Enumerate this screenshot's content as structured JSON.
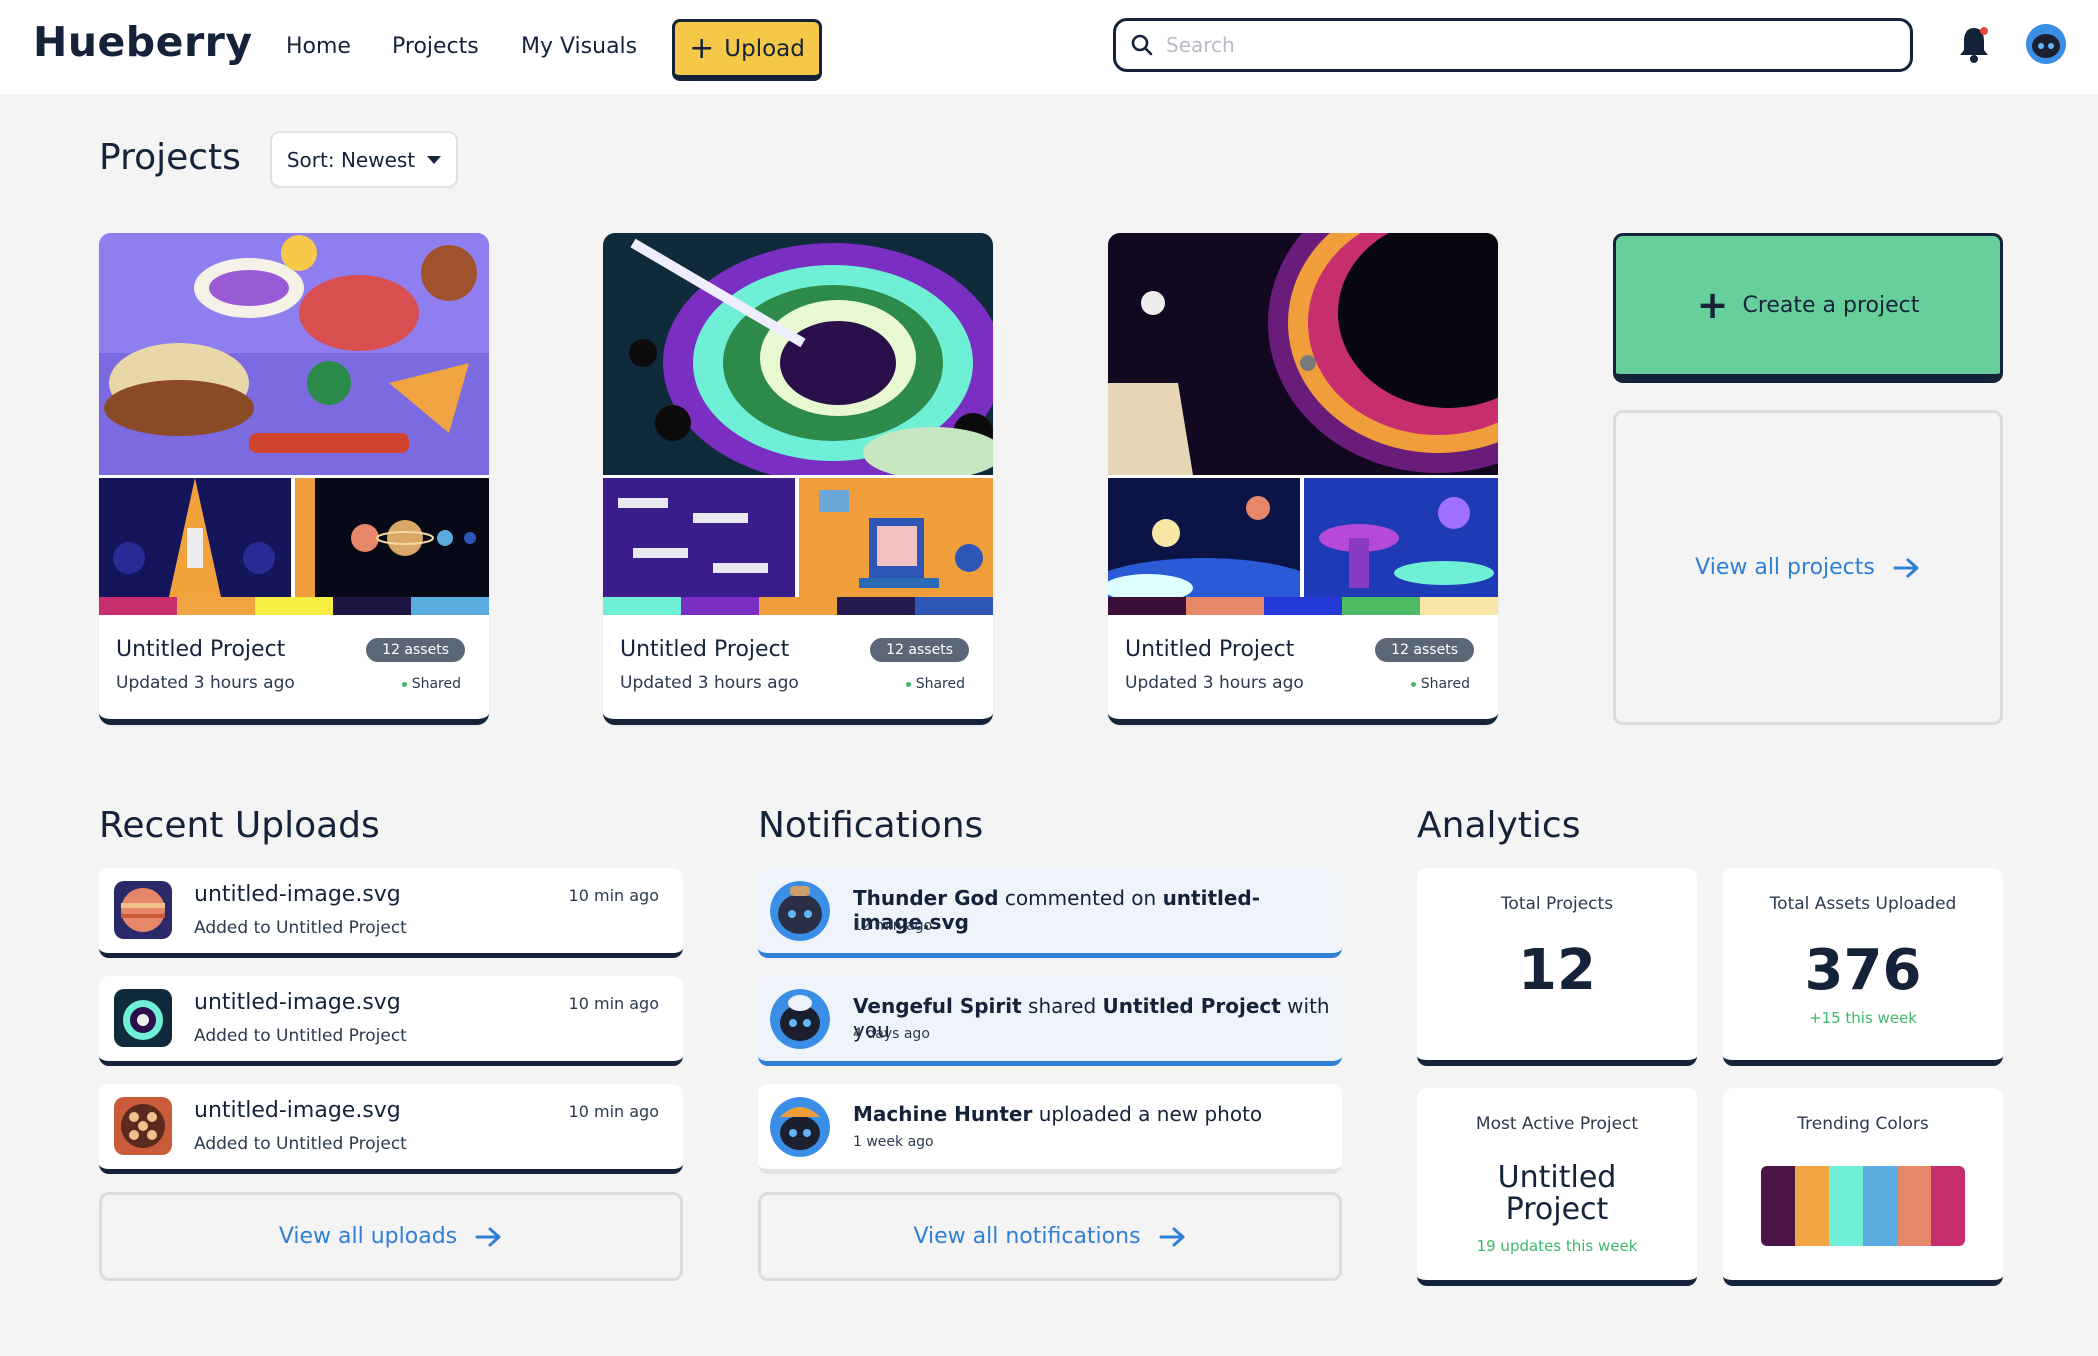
{
  "header": {
    "logo": "Hueberry",
    "nav": [
      "Home",
      "Projects",
      "My Visuals"
    ],
    "upload_label": "Upload",
    "search_placeholder": "Search",
    "colors": {
      "accent": "#f6c847",
      "brand_dark": "#14233a",
      "link": "#2f7fd6"
    }
  },
  "projects_section": {
    "title": "Projects",
    "sort_label": "Sort: Newest",
    "cards": [
      {
        "name": "Untitled Project",
        "updated": "Updated 3 hours ago",
        "assets": "12 assets",
        "status": "Shared",
        "palette": [
          "#c72e6e",
          "#f0a542",
          "#f7ec43",
          "#1c1640",
          "#5aabe0"
        ]
      },
      {
        "name": "Untitled Project",
        "updated": "Updated 3 hours ago",
        "assets": "12 assets",
        "status": "Shared",
        "palette": [
          "#6ff0d6",
          "#7a2ec2",
          "#f09e3c",
          "#241a4d",
          "#2e56b6"
        ]
      },
      {
        "name": "Untitled Project",
        "updated": "Updated 3 hours ago",
        "assets": "12 assets",
        "status": "Shared",
        "palette": [
          "#3a1038",
          "#e6876a",
          "#2438d8",
          "#4cbb63",
          "#f7e6a6"
        ]
      }
    ],
    "create_label": "Create a project",
    "view_all_label": "View all projects"
  },
  "recent_uploads": {
    "title": "Recent Uploads",
    "items": [
      {
        "filename": "untitled-image.svg",
        "subtitle": "Added to Untitled Project",
        "time": "10 min ago"
      },
      {
        "filename": "untitled-image.svg",
        "subtitle": "Added to Untitled Project",
        "time": "10 min ago"
      },
      {
        "filename": "untitled-image.svg",
        "subtitle": "Added to Untitled Project",
        "time": "10 min ago"
      }
    ],
    "view_all_label": "View all uploads"
  },
  "notifications": {
    "title": "Notifications",
    "items": [
      {
        "user": "Thunder God",
        "action": "commented on",
        "target": "untitled-image.svg",
        "suffix": "",
        "time": "12 min ago",
        "unread": true
      },
      {
        "user": "Vengeful Spirit",
        "action": "shared",
        "target": "Untitled Project",
        "suffix": "with you",
        "time": "4 days ago",
        "unread": true
      },
      {
        "user": "Machine Hunter",
        "action": "uploaded a new photo",
        "target": "",
        "suffix": "",
        "time": "1 week ago",
        "unread": false
      }
    ],
    "view_all_label": "View all notifications"
  },
  "analytics": {
    "title": "Analytics",
    "total_projects_label": "Total Projects",
    "total_projects_value": "12",
    "total_assets_label": "Total Assets Uploaded",
    "total_assets_value": "376",
    "total_assets_sub": "+15 this week",
    "most_active_label": "Most Active Project",
    "most_active_value": "Untitled Project",
    "most_active_sub": "19 updates this week",
    "trending_label": "Trending Colors",
    "trending_colors": [
      "#4a1446",
      "#f0a542",
      "#6ff0d6",
      "#5aabe0",
      "#e6876a",
      "#c72e6e"
    ]
  }
}
